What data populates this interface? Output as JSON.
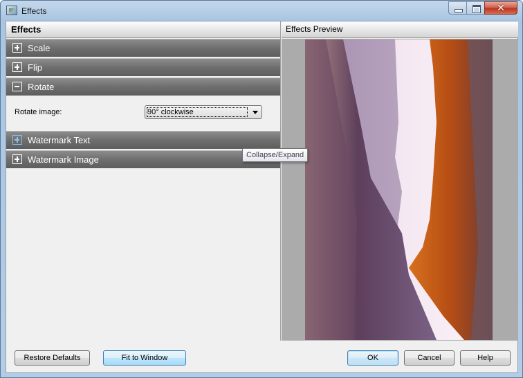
{
  "window": {
    "title": "Effects",
    "controls": {
      "minimize": "minimize",
      "maximize": "maximize",
      "close": "✕"
    }
  },
  "left_panel": {
    "header": "Effects",
    "sections": [
      {
        "label": "Scale",
        "state": "collapsed",
        "icon": "plus-box-icon"
      },
      {
        "label": "Flip",
        "state": "collapsed",
        "icon": "plus-box-icon"
      },
      {
        "label": "Rotate",
        "state": "expanded",
        "icon": "minus-box-icon"
      },
      {
        "label": "Watermark Text",
        "state": "collapsed",
        "icon": "plus-box-icon",
        "hovered": true
      },
      {
        "label": "Watermark Image",
        "state": "collapsed",
        "icon": "plus-box-icon"
      }
    ],
    "rotate": {
      "label": "Rotate image:",
      "selected": "90° clockwise"
    },
    "tooltip": "Collapse/Expand"
  },
  "right_panel": {
    "header": "Effects Preview",
    "image_description": "rotated canyon landscape photo"
  },
  "buttons": {
    "restore_defaults": "Restore Defaults",
    "fit_to_window": "Fit to Window",
    "ok": "OK",
    "cancel": "Cancel",
    "help": "Help"
  },
  "colors": {
    "section_header": "#6e6e6e",
    "accent_blue": "#3c7fb1",
    "preview_bg": "#ababab"
  }
}
